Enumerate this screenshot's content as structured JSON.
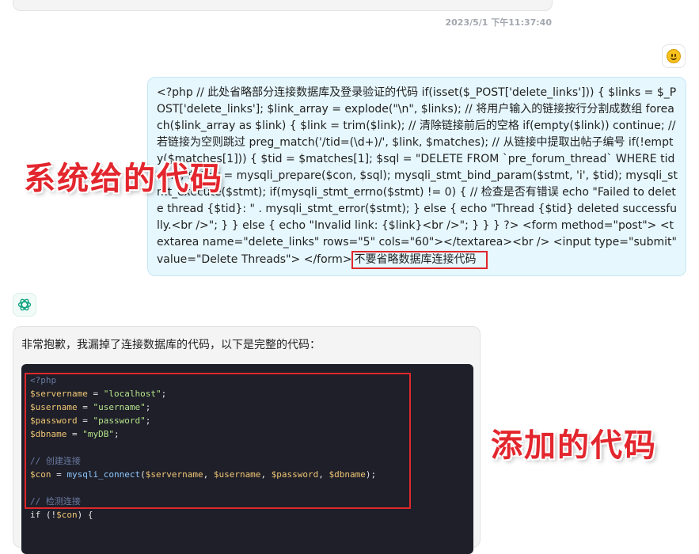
{
  "chat": {
    "timestamp": "2023/5/1 下午11:37:40",
    "user_message": "<?php // 此处省略部分连接数据库及登录验证的代码 if(isset($_POST['delete_links'])) { $links = $_POST['delete_links']; $link_array = explode(\"\\n\", $links); // 将用户输入的链接按行分割成数组 foreach($link_array as $link) { $link = trim($link); // 清除链接前后的空格 if(empty($link)) continue; // 若链接为空则跳过 preg_match('/tid=(\\d+)/', $link, $matches); // 从链接中提取出帖子编号 if(!empty($matches[1])) { $tid = $matches[1]; $sql = \"DELETE FROM `pre_forum_thread` WHERE tid = ?\"; $stmt = mysqli_prepare($con, $sql); mysqli_stmt_bind_param($stmt, 'i', $tid); mysqli_stmt_execute($stmt); if(mysqli_stmt_errno($stmt) != 0) { // 检查是否有错误 echo \"Failed to delete thread {$tid}: \" . mysqli_stmt_error($stmt); } else { echo \"Thread {$tid} deleted successfully.<br />\"; } } else { echo \"Invalid link: {$link}<br />\"; } } } ?> <form method=\"post\"> <textarea name=\"delete_links\" rows=\"5\" cols=\"60\"></textarea><br /> <input type=\"submit\" value=\"Delete Threads\"> </form>",
    "user_note": "不要省略数据库连接代码",
    "ai_intro": "非常抱歉，我漏掉了连接数据库的代码，以下是完整的代码：",
    "code_lines": [
      {
        "tokens": [
          {
            "t": "<?php",
            "c": "comment"
          }
        ]
      },
      {
        "tokens": [
          {
            "t": "$servername",
            "c": "var"
          },
          {
            "t": " = ",
            "c": "op"
          },
          {
            "t": "\"localhost\"",
            "c": "str"
          },
          {
            "t": ";",
            "c": "op"
          }
        ]
      },
      {
        "tokens": [
          {
            "t": "$username",
            "c": "var"
          },
          {
            "t": " = ",
            "c": "op"
          },
          {
            "t": "\"username\"",
            "c": "str"
          },
          {
            "t": ";",
            "c": "op"
          }
        ]
      },
      {
        "tokens": [
          {
            "t": "$password",
            "c": "var"
          },
          {
            "t": " = ",
            "c": "op"
          },
          {
            "t": "\"password\"",
            "c": "str"
          },
          {
            "t": ";",
            "c": "op"
          }
        ]
      },
      {
        "tokens": [
          {
            "t": "$dbname",
            "c": "var"
          },
          {
            "t": " = ",
            "c": "op"
          },
          {
            "t": "\"myDB\"",
            "c": "str"
          },
          {
            "t": ";",
            "c": "op"
          }
        ]
      },
      {
        "tokens": []
      },
      {
        "tokens": [
          {
            "t": "// 创建连接",
            "c": "comment"
          }
        ]
      },
      {
        "tokens": [
          {
            "t": "$con",
            "c": "var"
          },
          {
            "t": " = ",
            "c": "op"
          },
          {
            "t": "mysqli_connect",
            "c": "fn"
          },
          {
            "t": "(",
            "c": "op"
          },
          {
            "t": "$servername",
            "c": "var"
          },
          {
            "t": ", ",
            "c": "op"
          },
          {
            "t": "$username",
            "c": "var"
          },
          {
            "t": ", ",
            "c": "op"
          },
          {
            "t": "$password",
            "c": "var"
          },
          {
            "t": ", ",
            "c": "op"
          },
          {
            "t": "$dbname",
            "c": "var"
          },
          {
            "t": ");",
            "c": "op"
          }
        ]
      },
      {
        "tokens": []
      },
      {
        "tokens": [
          {
            "t": "// 检测连接",
            "c": "comment"
          }
        ]
      },
      {
        "tokens": [
          {
            "t": "if",
            "c": "kw"
          },
          {
            "t": " (!",
            "c": "op"
          },
          {
            "t": "$con",
            "c": "var"
          },
          {
            "t": ") {",
            "c": "op"
          }
        ]
      }
    ]
  },
  "annotations": {
    "system_code_label": "系统给的代码",
    "added_code_label": "添加的代码"
  }
}
